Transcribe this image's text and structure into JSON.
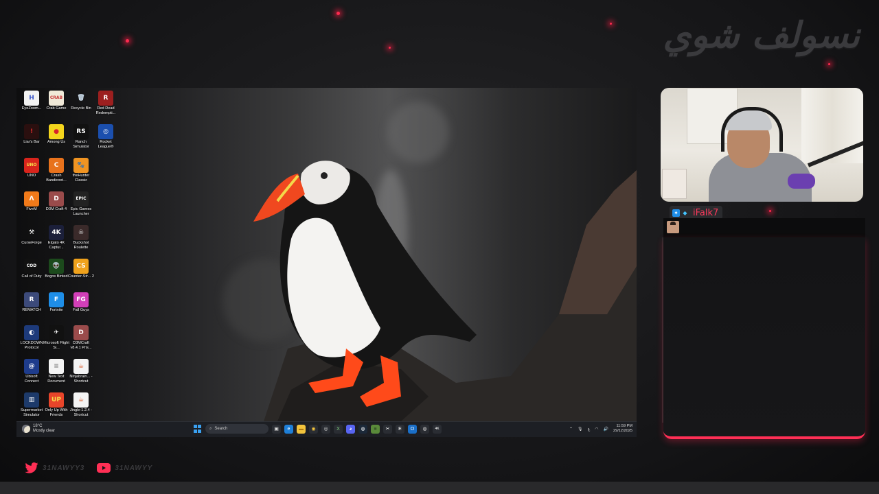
{
  "overlay": {
    "title": "نسولف شوي",
    "accent_color": "#ff2f55"
  },
  "desktop": {
    "icons": [
      {
        "label": "EyeZoom...",
        "icon": "eyezoom-icon",
        "glyph": "H",
        "bg": "#f2f2f2",
        "fg": "#3a56c8"
      },
      {
        "label": "Crab Game",
        "icon": "crab-game-icon",
        "glyph": "CRAB",
        "bg": "#f0e9d8",
        "fg": "#c83a3a"
      },
      {
        "label": "Recycle Bin",
        "icon": "recycle-bin-icon",
        "glyph": "🗑",
        "bg": "transparent",
        "fg": "#cfe0ef"
      },
      {
        "label": "Red Dead Redempti...",
        "icon": "red-dead-icon",
        "glyph": "R",
        "bg": "#9c1f1f",
        "fg": "#fff"
      },
      {
        "label": "Liar's Bar",
        "icon": "liars-bar-icon",
        "glyph": "!",
        "bg": "#2a0f0f",
        "fg": "#d82b2b"
      },
      {
        "label": "Among Us",
        "icon": "among-us-icon",
        "glyph": "●",
        "bg": "#f4d51c",
        "fg": "#d8202c"
      },
      {
        "label": "Ranch Simulator",
        "icon": "ranch-simulator-icon",
        "glyph": "RS",
        "bg": "#111",
        "fg": "#fff"
      },
      {
        "label": "Rocket League®",
        "icon": "rocket-league-icon",
        "glyph": "◎",
        "bg": "#1b4fae",
        "fg": "#fff"
      },
      {
        "label": "UNO",
        "icon": "uno-icon",
        "glyph": "UNO",
        "bg": "#d8241c",
        "fg": "#f7e04a"
      },
      {
        "label": "Crash Bandicoot...",
        "icon": "crash-bandicoot-icon",
        "glyph": "C",
        "bg": "#e8721c",
        "fg": "#fff"
      },
      {
        "label": "theHunter Classic",
        "icon": "thehunter-icon",
        "glyph": "🐾",
        "bg": "#f09422",
        "fg": "#fff"
      },
      {
        "label": "FiveM",
        "icon": "fivem-icon",
        "glyph": "Λ",
        "bg": "#f07a1a",
        "fg": "#fff"
      },
      {
        "label": "D3M Craft 4",
        "icon": "d3m-craft-icon",
        "glyph": "D",
        "bg": "#9a4b4b",
        "fg": "#fff"
      },
      {
        "label": "Epic Games Launcher",
        "icon": "epic-games-icon",
        "glyph": "EPIC",
        "bg": "#222",
        "fg": "#fff"
      },
      {
        "label": "CurseForge",
        "icon": "curseforge-icon",
        "glyph": "⚒",
        "bg": "transparent",
        "fg": "#fff"
      },
      {
        "label": "Elgato 4K Captur...",
        "icon": "elgato-icon",
        "glyph": "4K",
        "bg": "#1b1f3a",
        "fg": "#fff"
      },
      {
        "label": "Buckshot Roulette",
        "icon": "buckshot-roulette-icon",
        "glyph": "☠",
        "bg": "#3a2a2a",
        "fg": "#ddd"
      },
      {
        "label": "Call of Duty",
        "icon": "call-of-duty-icon",
        "glyph": "COD",
        "bg": "#111",
        "fg": "#fff"
      },
      {
        "label": "Bogos Binted",
        "icon": "bogos-binted-icon",
        "glyph": "👽",
        "bg": "#1c4a1c",
        "fg": "#8ee06a"
      },
      {
        "label": "Counter-Str... 2",
        "icon": "counter-strike-icon",
        "glyph": "CS",
        "bg": "#f0a21c",
        "fg": "#fff"
      },
      {
        "label": "REMATCH",
        "icon": "rematch-icon",
        "glyph": "R",
        "bg": "#3c4a7a",
        "fg": "#fff"
      },
      {
        "label": "Fortnite",
        "icon": "fortnite-icon",
        "glyph": "F",
        "bg": "#1e8ee8",
        "fg": "#fff"
      },
      {
        "label": "Fall Guys",
        "icon": "fall-guys-icon",
        "glyph": "FG",
        "bg": "#d23fb8",
        "fg": "#fff"
      },
      {
        "label": "LOCKDOWN Protocol",
        "icon": "lockdown-protocol-icon",
        "glyph": "◐",
        "bg": "#1d3a7a",
        "fg": "#fff"
      },
      {
        "label": "Microsoft Flight Si...",
        "icon": "flight-simulator-icon",
        "glyph": "✈",
        "bg": "#111",
        "fg": "#fff"
      },
      {
        "label": "D3MCraft v8.4.1 Pris...",
        "icon": "d3mcraft-icon",
        "glyph": "D",
        "bg": "#9a4b4b",
        "fg": "#fff"
      },
      {
        "label": "Ubisoft Connect",
        "icon": "ubisoft-connect-icon",
        "glyph": "@",
        "bg": "#1e3c8c",
        "fg": "#fff"
      },
      {
        "label": "New Text Document",
        "icon": "text-document-icon",
        "glyph": "≡",
        "bg": "#f4f4f4",
        "fg": "#888"
      },
      {
        "label": "Ninjabrain... - Shortcut",
        "icon": "java-shortcut-icon",
        "glyph": "☕",
        "bg": "#f4f4f4",
        "fg": "#d8501c"
      },
      {
        "label": "Supermarket Simulator",
        "icon": "supermarket-simulator-icon",
        "glyph": "▥",
        "bg": "#1d3a6a",
        "fg": "#fff"
      },
      {
        "label": "Only Up With Friends",
        "icon": "only-up-icon",
        "glyph": "UP",
        "bg": "#e8452a",
        "fg": "#f7e04a"
      },
      {
        "label": "Jingle-1.2.4 - Shortcut",
        "icon": "java-shortcut-icon",
        "glyph": "☕",
        "bg": "#f4f4f4",
        "fg": "#d8501c"
      }
    ]
  },
  "taskbar": {
    "weather_temp": "18°C",
    "weather_desc": "Mostly clear",
    "search_placeholder": "Search",
    "lang": "ع",
    "time": "11:59 PM",
    "date": "29/12/2025",
    "pinned_apps": [
      {
        "icon": "task-view-icon",
        "glyph": "▣",
        "bg": "#2a2d33",
        "fg": "#ddd"
      },
      {
        "icon": "edge-icon",
        "glyph": "e",
        "bg": "#1e7fd8",
        "fg": "#fff"
      },
      {
        "icon": "file-explorer-icon",
        "glyph": "▬",
        "bg": "#f2c33c",
        "fg": "#b07a10"
      },
      {
        "icon": "chrome-icon",
        "glyph": "◉",
        "bg": "#2a2d33",
        "fg": "#f2c33c"
      },
      {
        "icon": "obs-icon",
        "glyph": "◎",
        "bg": "#2a2d33",
        "fg": "#ddd"
      },
      {
        "icon": "xbox-app-icon",
        "glyph": "X",
        "bg": "#2a2d33",
        "fg": "#7fd07f"
      },
      {
        "icon": "discord-icon",
        "glyph": "◕",
        "bg": "#5865f2",
        "fg": "#fff"
      },
      {
        "icon": "steam-icon",
        "glyph": "◍",
        "bg": "#1b2838",
        "fg": "#fff"
      },
      {
        "icon": "minecraft-launcher-icon",
        "glyph": "■",
        "bg": "#5a8a3a",
        "fg": "#3a5a2a"
      },
      {
        "icon": "capcut-icon",
        "glyph": "✂",
        "bg": "#2a2d33",
        "fg": "#fff"
      },
      {
        "icon": "epic-games-icon",
        "glyph": "E",
        "bg": "#2a2d33",
        "fg": "#fff"
      },
      {
        "icon": "outlook-icon",
        "glyph": "O",
        "bg": "#1a6fc8",
        "fg": "#fff"
      },
      {
        "icon": "elgato-capture-icon",
        "glyph": "◍",
        "bg": "#2a2d33",
        "fg": "#ddd"
      },
      {
        "icon": "elgato-4k-icon",
        "glyph": "4K",
        "bg": "#2a2d33",
        "fg": "#fff"
      }
    ]
  },
  "chat": {
    "username": "iFalk7",
    "badges": [
      {
        "icon": "verified-badge-icon",
        "glyph": "✦",
        "bg": "#1f8ee8",
        "fg": "#fff"
      },
      {
        "icon": "gem-badge-icon",
        "glyph": "◆",
        "bg": "#2a2b2e",
        "fg": "#44c4ff"
      }
    ]
  },
  "socials": [
    {
      "platform": "twitter",
      "icon": "twitter-icon",
      "handle": "31NAWYY3"
    },
    {
      "platform": "youtube",
      "icon": "youtube-icon",
      "handle": "31NAWYY"
    }
  ]
}
